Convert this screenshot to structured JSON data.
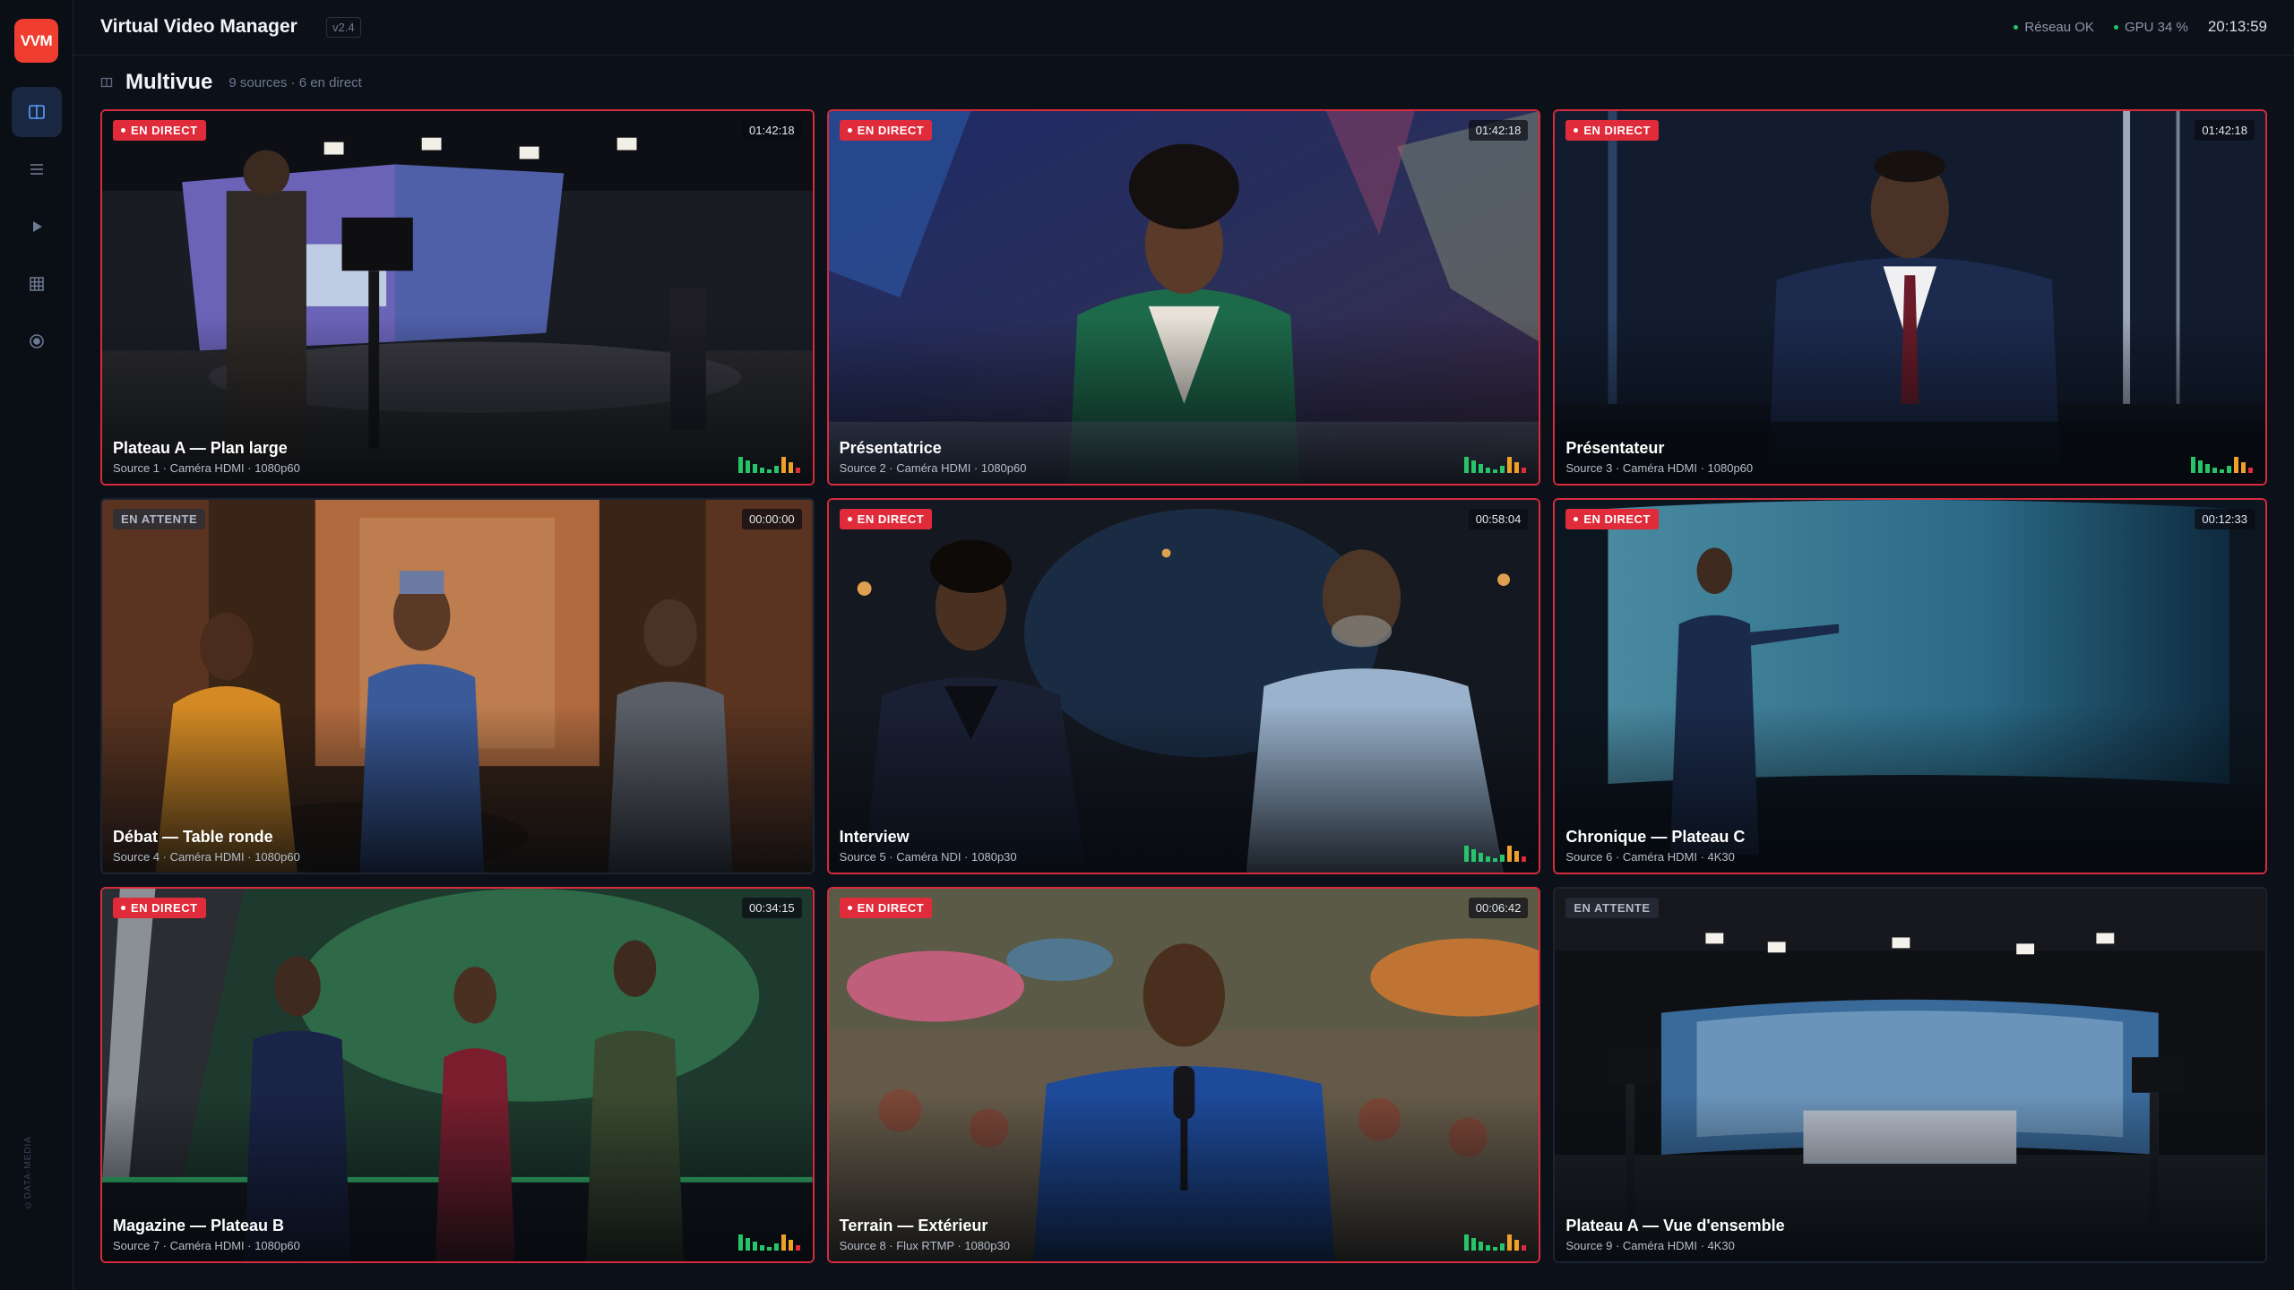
{
  "app": {
    "logo": "VVM",
    "title": "Virtual Video Manager",
    "version": "v2.4"
  },
  "status": {
    "network": "Réseau OK",
    "gpu": "GPU 34 %",
    "clock": "20:13:59"
  },
  "section": {
    "title": "Multivue",
    "meta": "9 sources · 6 en direct"
  },
  "sidebar": {
    "items": [
      {
        "icon": "multiview-icon",
        "active": true
      },
      {
        "icon": "list-icon",
        "active": false
      },
      {
        "icon": "play-icon",
        "active": false
      },
      {
        "icon": "grid-icon",
        "active": false
      },
      {
        "icon": "record-icon",
        "active": false
      }
    ],
    "credit": "©DATA-MEDIA"
  },
  "colors": {
    "live": "#e02b3b",
    "accent": "#5aa0ff",
    "ok": "#27c46a",
    "logo": "#ef3e2f"
  },
  "sources": [
    {
      "status": "EN DIRECT",
      "timer": "01:42:18",
      "title": "Plateau A — Plan large",
      "subtitle": "Source 1 · Caméra HDMI · 1080p60",
      "vu": true
    },
    {
      "status": "EN DIRECT",
      "timer": "01:42:18",
      "title": "Présentatrice",
      "subtitle": "Source 2 · Caméra HDMI · 1080p60",
      "vu": true
    },
    {
      "status": "EN DIRECT",
      "timer": "01:42:18",
      "title": "Présentateur",
      "subtitle": "Source 3 · Caméra HDMI · 1080p60",
      "vu": true
    },
    {
      "status": "EN ATTENTE",
      "timer": "00:00:00",
      "title": "Débat — Table ronde",
      "subtitle": "Source 4 · Caméra HDMI · 1080p60",
      "vu": false
    },
    {
      "status": "EN DIRECT",
      "timer": "00:58:04",
      "title": "Interview",
      "subtitle": "Source 5 · Caméra NDI · 1080p30",
      "vu": true
    },
    {
      "status": "EN DIRECT",
      "timer": "00:12:33",
      "title": "Chronique — Plateau C",
      "subtitle": "Source 6 · Caméra HDMI · 4K30",
      "vu": false
    },
    {
      "status": "EN DIRECT",
      "timer": "00:34:15",
      "title": "Magazine — Plateau B",
      "subtitle": "Source 7 · Caméra HDMI · 1080p60",
      "vu": true
    },
    {
      "status": "EN DIRECT",
      "timer": "00:06:42",
      "title": "Terrain — Extérieur",
      "subtitle": "Source 8 · Flux RTMP · 1080p30",
      "vu": true
    },
    {
      "status": "EN ATTENTE",
      "timer": "",
      "title": "Plateau A — Vue d'ensemble",
      "subtitle": "Source 9 · Caméra HDMI · 4K30",
      "vu": false
    }
  ]
}
